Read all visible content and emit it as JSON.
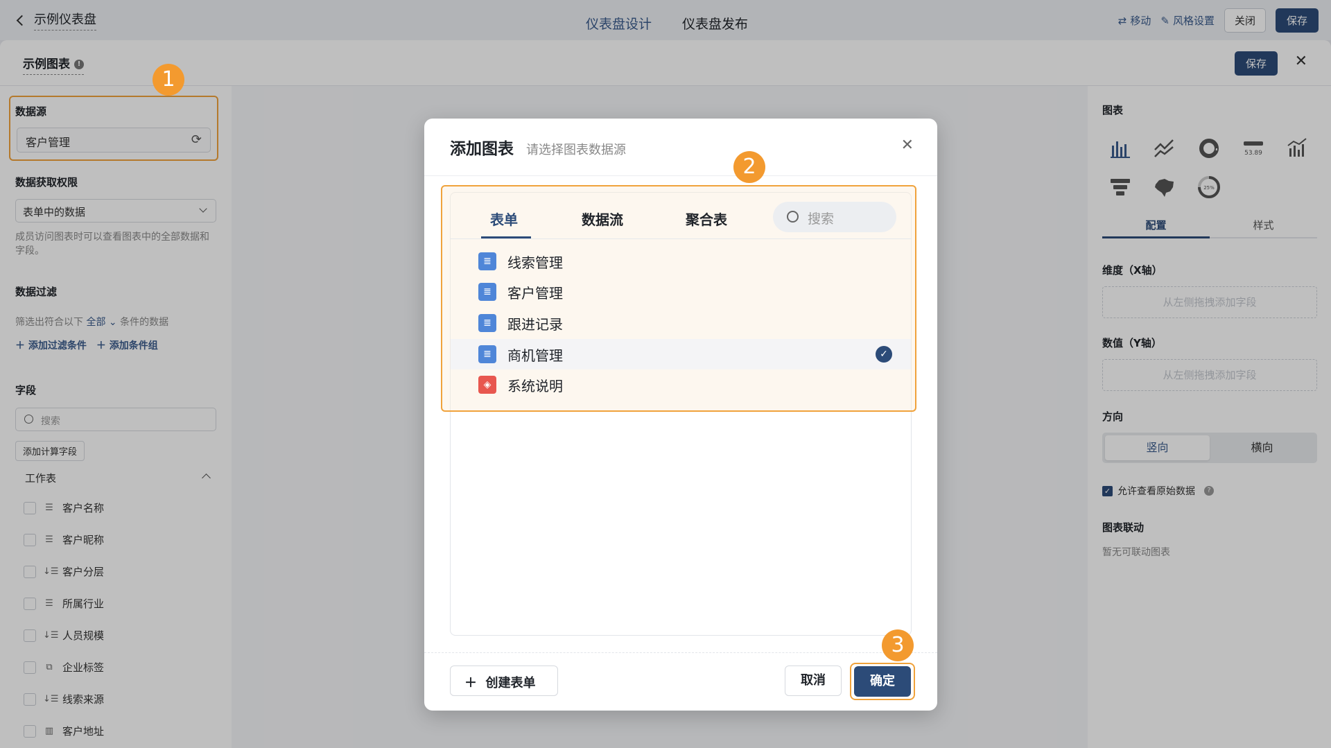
{
  "topbar": {
    "back_title": "示例仪表盘",
    "tab_design": "仪表盘设计",
    "tab_publish": "仪表盘发布",
    "move": "移动",
    "style_settings": "风格设置",
    "close": "关闭",
    "save": "保存"
  },
  "subheader": {
    "title": "示例图表",
    "save": "保存"
  },
  "left": {
    "datasource_label": "数据源",
    "datasource_value": "客户管理",
    "permission_label": "数据获取权限",
    "permission_value": "表单中的数据",
    "permission_hint": "成员访问图表时可以查看图表中的全部数据和字段。",
    "filter_label": "数据过滤",
    "filter_prefix": "筛选出符合以下",
    "filter_mode": "全部",
    "filter_suffix": "条件的数据",
    "add_filter": "添加过滤条件",
    "add_group": "添加条件组",
    "fields_label": "字段",
    "search_placeholder": "搜索",
    "add_calc_field": "添加计算字段",
    "worksheet": "工作表",
    "fields": [
      {
        "name": "客户名称",
        "icon": "text-lines-icon"
      },
      {
        "name": "客户昵称",
        "icon": "text-lines-icon"
      },
      {
        "name": "客户分层",
        "icon": "sort-list-icon"
      },
      {
        "name": "所属行业",
        "icon": "text-lines-icon"
      },
      {
        "name": "人员规模",
        "icon": "sort-list-icon"
      },
      {
        "name": "企业标签",
        "icon": "tag-copy-icon"
      },
      {
        "name": "线索来源",
        "icon": "sort-list-icon"
      },
      {
        "name": "客户地址",
        "icon": "building-icon"
      }
    ]
  },
  "right": {
    "chart_label": "图表",
    "chart_types": [
      "bar-chart-icon",
      "line-chart-icon",
      "pie-chart-icon",
      "number-card-icon",
      "column-line-icon",
      "funnel-icon",
      "map-icon",
      "gauge-icon"
    ],
    "number_card_sample": "53.89",
    "gauge_sample": "25%",
    "tab_config": "配置",
    "tab_style": "样式",
    "dimension_label": "维度（X轴）",
    "dimension_placeholder": "从左侧拖拽添加字段",
    "value_label": "数值（Y轴）",
    "value_placeholder": "从左侧拖拽添加字段",
    "direction_label": "方向",
    "direction_vertical": "竖向",
    "direction_horizontal": "横向",
    "allow_raw": "允许查看原始数据",
    "linkage_label": "图表联动",
    "linkage_empty": "暂无可联动图表"
  },
  "modal": {
    "title": "添加图表",
    "subtitle": "请选择图表数据源",
    "tabs": [
      "表单",
      "数据流",
      "聚合表"
    ],
    "search_placeholder": "搜索",
    "items": [
      {
        "name": "线索管理",
        "icon": "form-doc-icon"
      },
      {
        "name": "客户管理",
        "icon": "form-doc-icon"
      },
      {
        "name": "跟进记录",
        "icon": "form-doc-icon"
      },
      {
        "name": "商机管理",
        "icon": "form-doc-icon",
        "selected": true
      },
      {
        "name": "系统说明",
        "icon": "cube-icon"
      }
    ],
    "create_form": "创建表单",
    "cancel": "取消",
    "confirm": "确定"
  },
  "badges": [
    "1",
    "2",
    "3"
  ],
  "colors": {
    "primary": "#2c4b78",
    "highlight": "#f0a23b",
    "badge": "#f39a2f",
    "doc_icon": "#4f86d8",
    "cube_icon": "#e8574f"
  }
}
